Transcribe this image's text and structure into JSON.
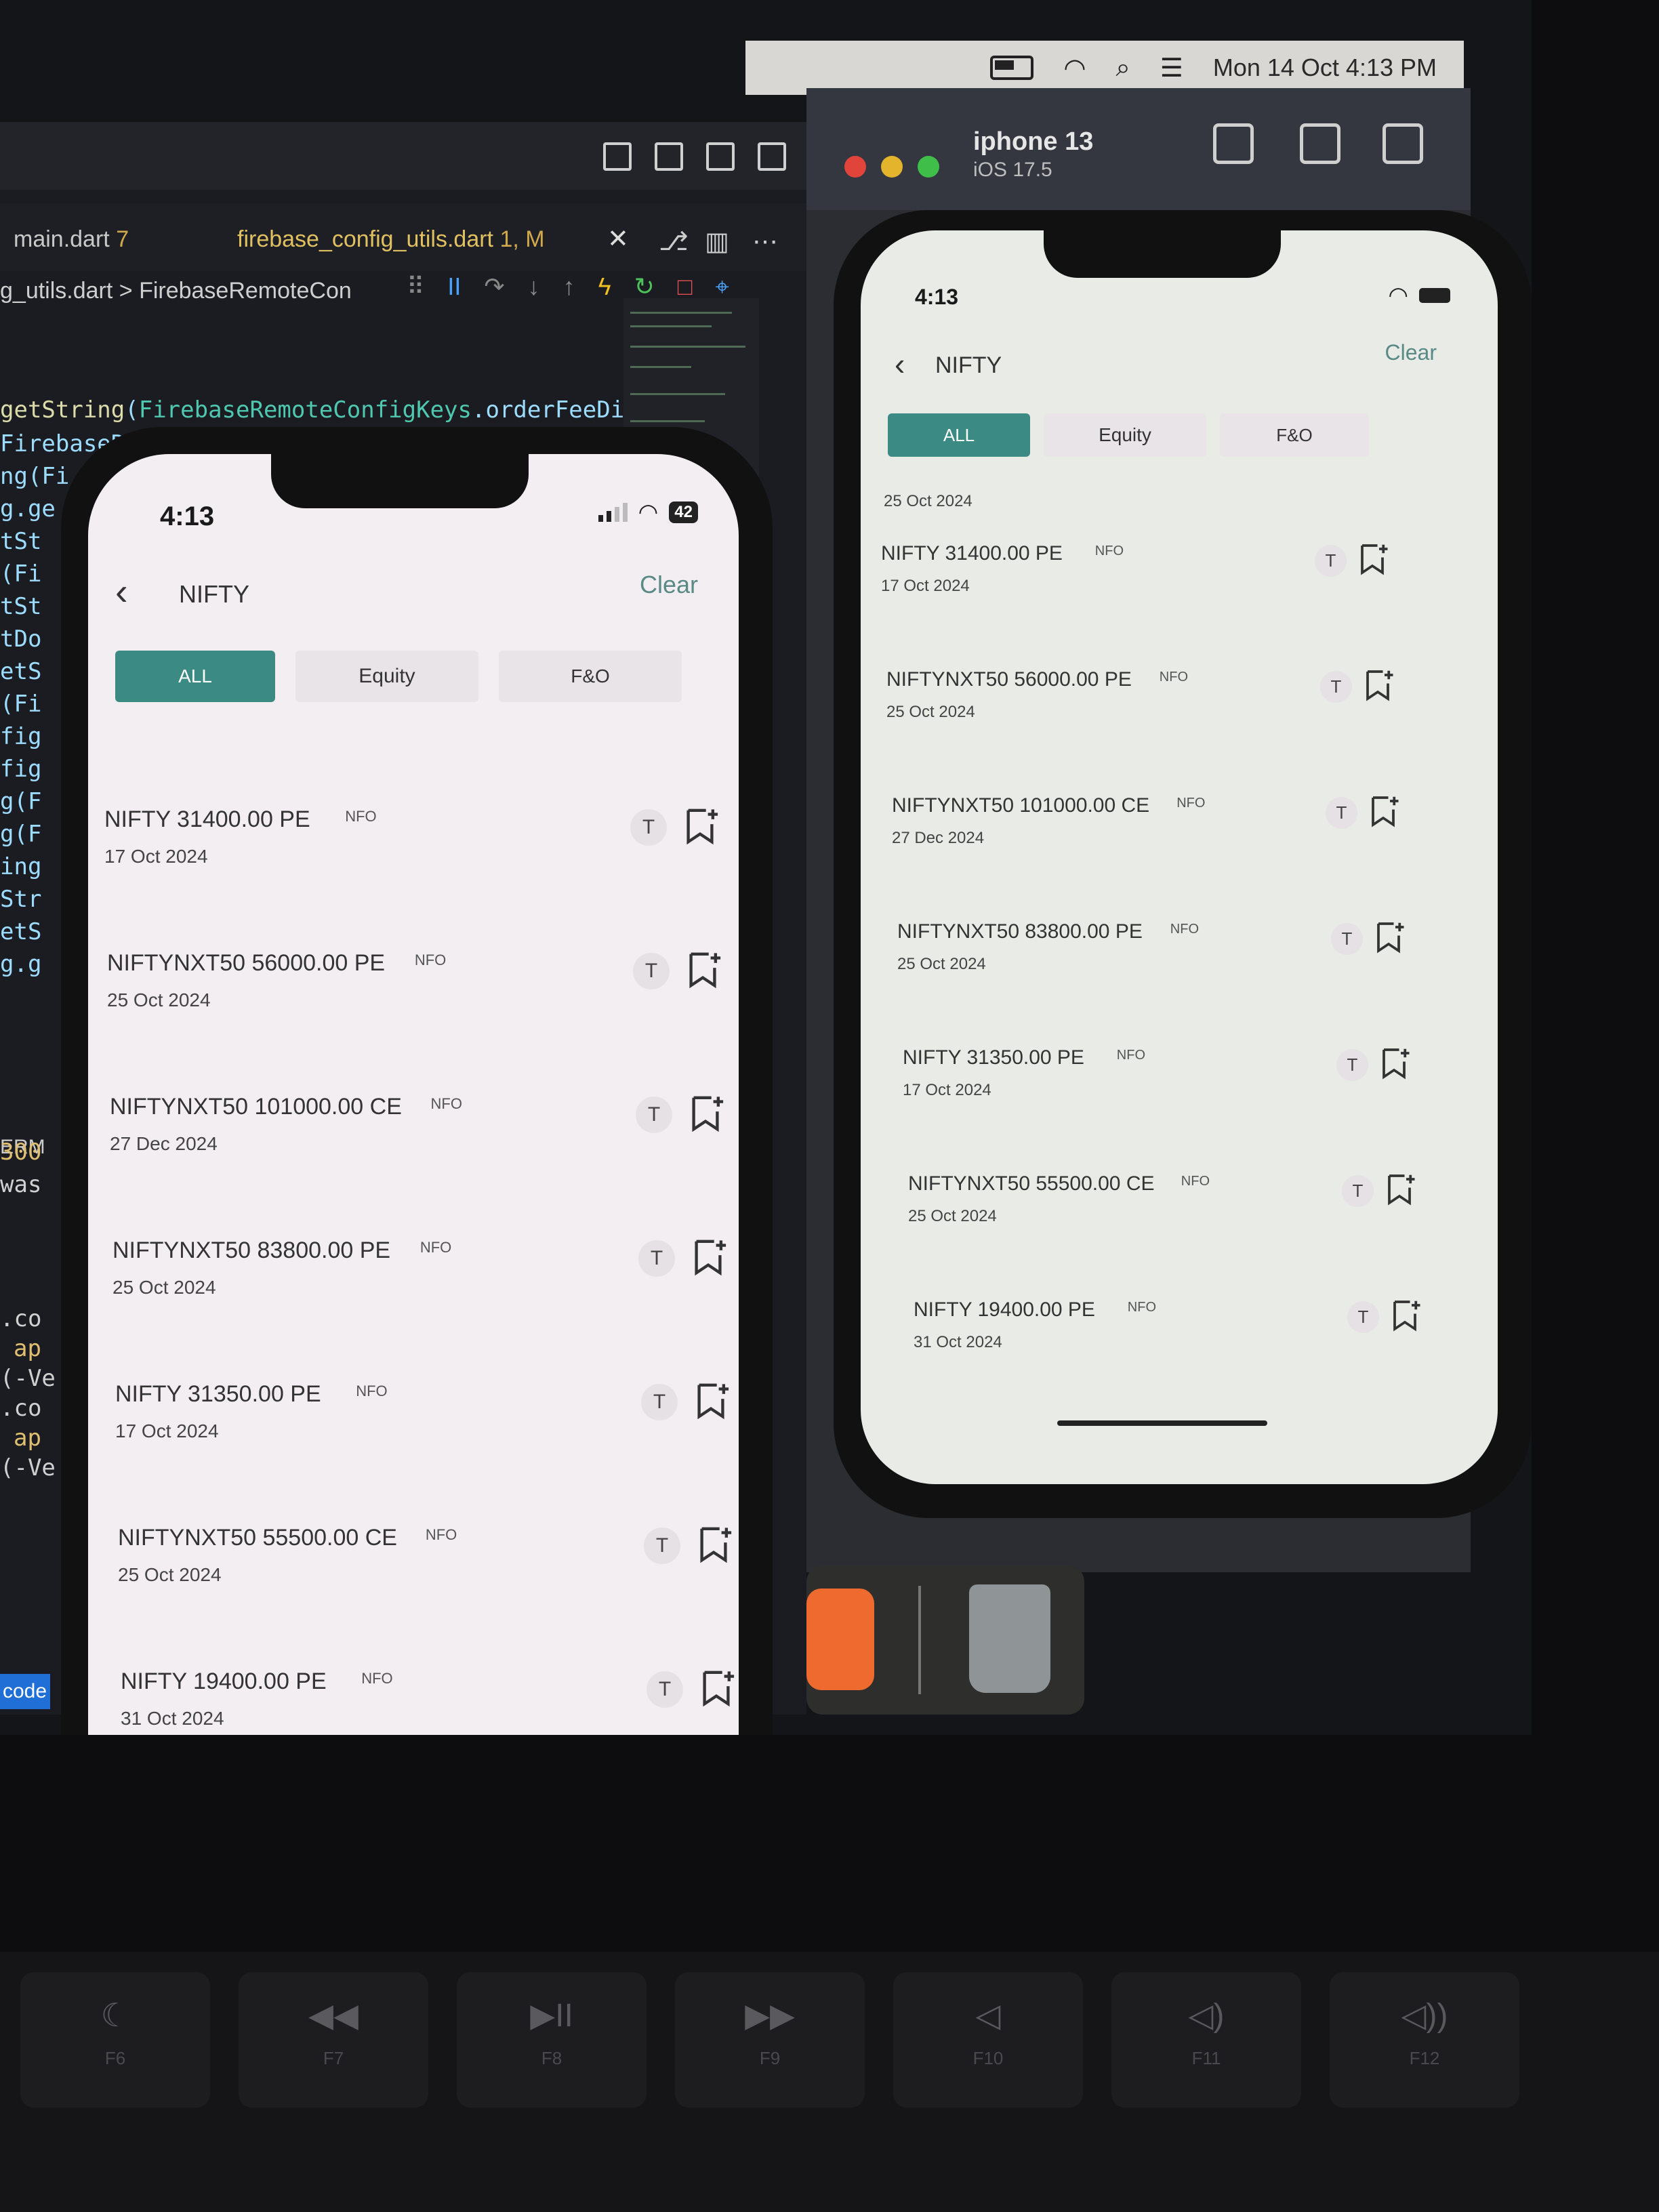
{
  "menubar": {
    "datetime": "Mon 14 Oct  4:13 PM",
    "icons": [
      "battery-icon",
      "wifi-icon",
      "search-icon",
      "control-center-icon"
    ]
  },
  "editor": {
    "tabs": [
      {
        "label": "main.dart",
        "badge": "7"
      },
      {
        "label": "firebase_config_utils.dart",
        "badge": "1, M"
      }
    ],
    "breadcrumb": "g_utils.dart > FirebaseRemoteCon",
    "code_lines": [
      "getString(FirebaseRemoteConfigKeys.orderFeeDiscl",
      "FirebaseRe",
      "ng(Fi",
      "g.ge",
      "tSt",
      "(Fi",
      "tSt",
      "tDo",
      "etS",
      "(Fi",
      "fig",
      "fig",
      "g(F",
      "g(F",
      "ing",
      "Str",
      "etS",
      "g.g"
    ],
    "terminal_label": "ERM",
    "terminal_lines": [
      "300",
      "was"
    ],
    "lower_lines": [
      ".co",
      "ap",
      "(-Ve",
      ".co",
      "ap",
      "(-Ve"
    ],
    "code_badge": "code"
  },
  "simulator": {
    "title": "iphone 13",
    "subtitle": "iOS 17.5"
  },
  "phone_left": {
    "time": "4:13",
    "battery": "42",
    "query": "NIFTY",
    "clear": "Clear",
    "tabs": [
      "ALL",
      "Equity",
      "F&O"
    ],
    "rows": [
      {
        "name": "NIFTY 31400.00 PE",
        "exchange": "NFO",
        "date": "17 Oct 2024",
        "tag": "T"
      },
      {
        "name": "NIFTYNXT50 56000.00 PE",
        "exchange": "NFO",
        "date": "25 Oct 2024",
        "tag": "T"
      },
      {
        "name": "NIFTYNXT50 101000.00 CE",
        "exchange": "NFO",
        "date": "27 Dec 2024",
        "tag": "T"
      },
      {
        "name": "NIFTYNXT50 83800.00 PE",
        "exchange": "NFO",
        "date": "25 Oct 2024",
        "tag": "T"
      },
      {
        "name": "NIFTY 31350.00 PE",
        "exchange": "NFO",
        "date": "17 Oct 2024",
        "tag": "T"
      },
      {
        "name": "NIFTYNXT50 55500.00 CE",
        "exchange": "NFO",
        "date": "25 Oct 2024",
        "tag": "T"
      },
      {
        "name": "NIFTY 19400.00 PE",
        "exchange": "NFO",
        "date": "31 Oct 2024",
        "tag": "T"
      }
    ]
  },
  "phone_right": {
    "time": "4:13",
    "query": "NIFTY",
    "clear": "Clear",
    "tabs": [
      "ALL",
      "Equity",
      "F&O"
    ],
    "partial_date": "25 Oct 2024",
    "rows": [
      {
        "name": "NIFTY 31400.00 PE",
        "exchange": "NFO",
        "date": "17 Oct 2024",
        "tag": "T"
      },
      {
        "name": "NIFTYNXT50 56000.00 PE",
        "exchange": "NFO",
        "date": "25 Oct 2024",
        "tag": "T"
      },
      {
        "name": "NIFTYNXT50 101000.00 CE",
        "exchange": "NFO",
        "date": "27 Dec 2024",
        "tag": "T"
      },
      {
        "name": "NIFTYNXT50 83800.00 PE",
        "exchange": "NFO",
        "date": "25 Oct 2024",
        "tag": "T"
      },
      {
        "name": "NIFTY 31350.00 PE",
        "exchange": "NFO",
        "date": "17 Oct 2024",
        "tag": "T"
      },
      {
        "name": "NIFTYNXT50 55500.00 CE",
        "exchange": "NFO",
        "date": "25 Oct 2024",
        "tag": "T"
      },
      {
        "name": "NIFTY 19400.00 PE",
        "exchange": "NFO",
        "date": "31 Oct 2024",
        "tag": "T"
      }
    ]
  },
  "keyboard": {
    "keys": [
      {
        "glyph": "☾",
        "label": "F6"
      },
      {
        "glyph": "◀◀",
        "label": "F7"
      },
      {
        "glyph": "▶II",
        "label": "F8"
      },
      {
        "glyph": "▶▶",
        "label": "F9"
      },
      {
        "glyph": "◁",
        "label": "F10"
      },
      {
        "glyph": "◁)",
        "label": "F11"
      },
      {
        "glyph": "◁))",
        "label": "F12"
      }
    ]
  },
  "colors": {
    "accent_tab": "#3b8a83",
    "clear_text": "#5a8a86",
    "phone_bg": "#f2eef1"
  }
}
